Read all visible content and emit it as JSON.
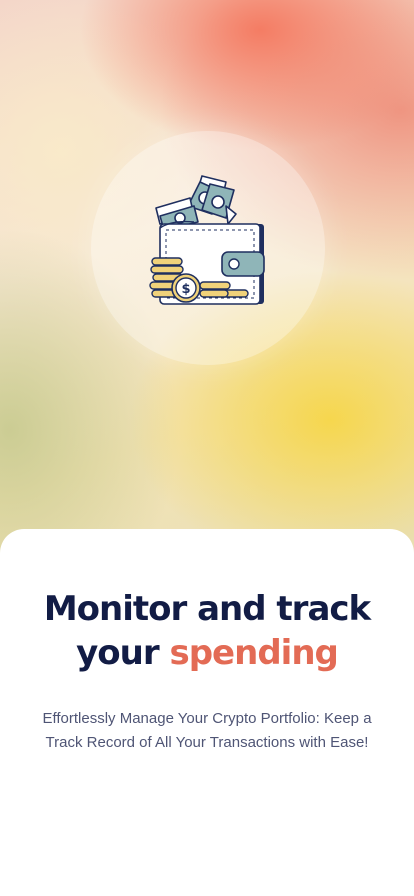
{
  "onboarding": {
    "illustration_icon": "wallet-with-money-and-coins-icon",
    "coin_symbol": "$",
    "headline_part1": "Monitor and track",
    "headline_part2": "your",
    "headline_accent": "spending",
    "description": "Effortlessly Manage Your Crypto Portfolio: Keep a Track Record of All Your Transactions with Ease!"
  },
  "colors": {
    "headline": "#121c45",
    "accent": "#e36b55",
    "body_text": "#4f5575",
    "card_background": "#ffffff",
    "wallet_dark": "#1f2f5f",
    "wallet_teal": "#8fb5b8",
    "coin_gold": "#f0d27a"
  }
}
